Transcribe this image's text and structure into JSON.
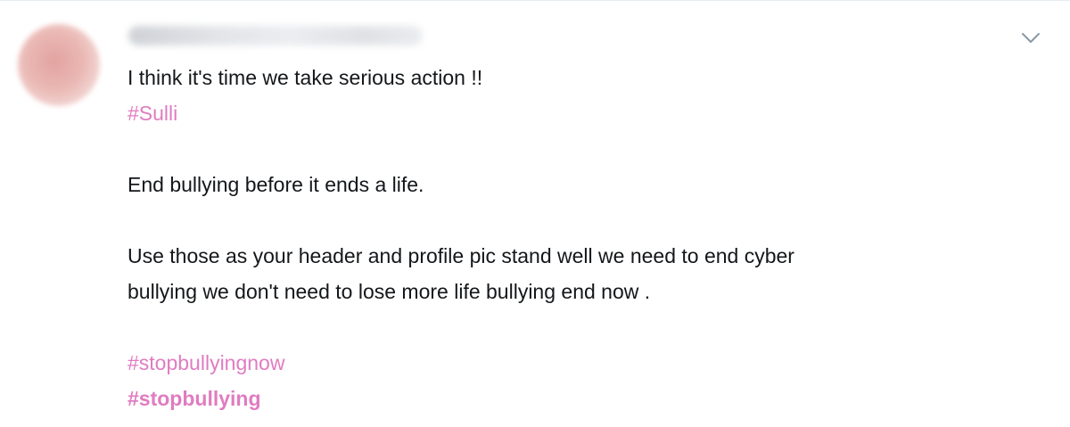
{
  "tweet": {
    "line1": "I think it's time we take serious action !!",
    "hashtag_sulli": "#Sulli",
    "line2": "End bullying before it ends a life.",
    "line3a": "Use those as your header and profile pic stand well we need to end cyber",
    "line3b": "bullying we don't need to lose more life bullying end now .",
    "hashtag_stopbullyingnow": "#stopbullyingnow",
    "hashtag_stopbullying": "#stopbullying"
  },
  "colors": {
    "hashtag": "#e07cc0",
    "text": "#14171a",
    "chevron": "#8899a6"
  },
  "icons": {
    "menu": "chevron-down-icon"
  }
}
